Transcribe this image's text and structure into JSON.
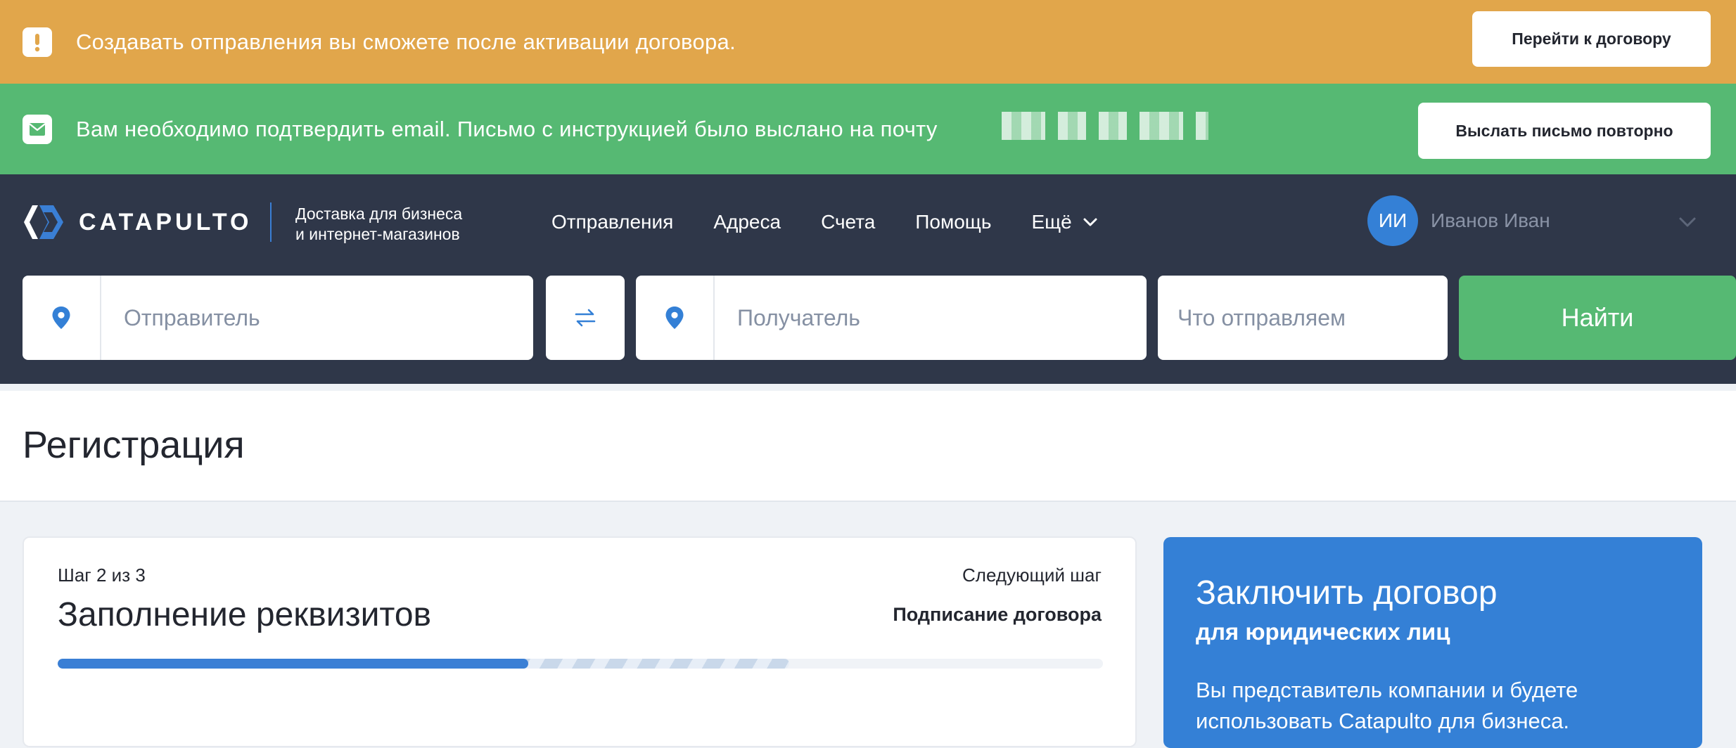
{
  "banners": {
    "warning": {
      "text": "Создавать отправления вы сможете после активации договора.",
      "button_label": "Перейти к договору"
    },
    "email": {
      "text": "Вам необходимо подтвердить email. Письмо с инструкцией было выслано на почту",
      "button_label": "Выслать письмо повторно"
    }
  },
  "header": {
    "logo_text": "CATAPULTO",
    "tagline_line1": "Доставка для бизнеса",
    "tagline_line2": "и интернет-магазинов",
    "nav": [
      {
        "label": "Отправления"
      },
      {
        "label": "Адреса"
      },
      {
        "label": "Счета"
      },
      {
        "label": "Помощь"
      },
      {
        "label": "Ещё"
      }
    ],
    "user": {
      "initials": "ИИ",
      "name": "Иванов Иван"
    }
  },
  "search": {
    "sender_placeholder": "Отправитель",
    "recipient_placeholder": "Получатель",
    "cargo_placeholder": "Что отправляем",
    "submit_label": "Найти"
  },
  "page": {
    "title": "Регистрация"
  },
  "step_card": {
    "step_count": "Шаг 2 из 3",
    "title": "Заполнение реквизитов",
    "next_label": "Следующий шаг",
    "next_value": "Подписание договора",
    "progress_filled": 0.45,
    "progress_pending": 0.7
  },
  "promo": {
    "title": "Заключить договор",
    "subtitle": "для юридических лиц",
    "text": "Вы представитель компании и будете использовать Catapulto для бизнеса."
  },
  "colors": {
    "warning": "#e1a64b",
    "success": "#56b973",
    "header": "#2f3749",
    "accent": "#3480d6"
  }
}
